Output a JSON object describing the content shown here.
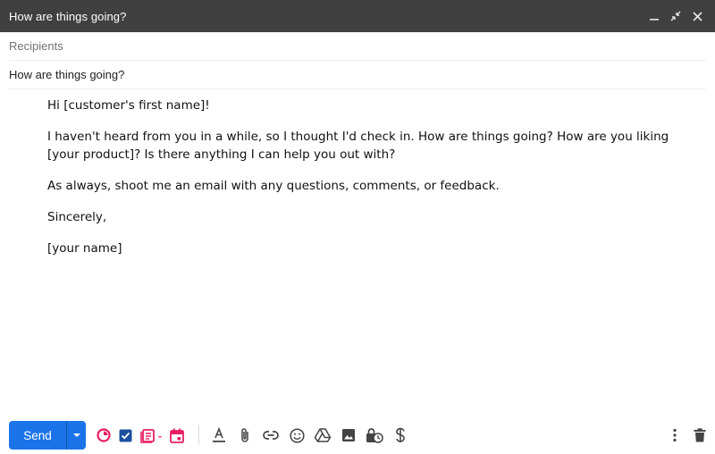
{
  "window": {
    "title": "How are things going?"
  },
  "compose": {
    "recipients_placeholder": "Recipients",
    "subject": "How are things going?"
  },
  "message": {
    "paragraphs": [
      "Hi [customer's first name]!",
      "I haven't heard from you in a while, so I thought I'd check in. How are things going? How are you liking [your product]? Is there anything I can help you out with?",
      "As always, shoot me an email with any questions, comments, or feedback.",
      "Sincerely,",
      "[your name]"
    ]
  },
  "toolbar": {
    "send_label": "Send",
    "icons": [
      "send-options-icon",
      "extension-pie-icon",
      "checkbox-icon",
      "template-icon",
      "calendar-icon",
      "formatting-icon",
      "attach-icon",
      "link-icon",
      "emoji-icon",
      "drive-icon",
      "photo-icon",
      "confidential-icon",
      "payment-icon",
      "more-options-icon",
      "trash-icon"
    ]
  },
  "colors": {
    "titlebar": "#404040",
    "send": "#1a73e8",
    "extension_accent": "#e91e63",
    "checkbox": "#1a4fa0"
  }
}
